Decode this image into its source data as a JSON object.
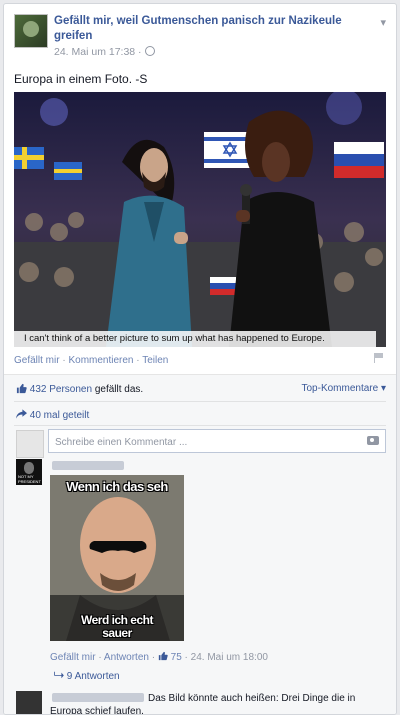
{
  "post": {
    "page_name": "Gefällt mir, weil Gutmenschen panisch zur Nazikeule greifen",
    "timestamp": "24. Mai um 17:38 ·",
    "text": "Europa in einem Foto. -S",
    "photo_caption": "I can't think of a better picture to sum up what has happened to Europe.",
    "actions": {
      "like": "Gefällt mir",
      "comment": "Kommentieren",
      "share": "Teilen",
      "separator": "·"
    }
  },
  "ufi": {
    "likes_count": "432 Personen",
    "likes_suffix": "gefällt das.",
    "top_comments": "Top-Kommentare ▾",
    "shares": "40 mal geteilt",
    "comment_placeholder": "Schreibe einen Kommentar ..."
  },
  "comments": [
    {
      "avatar_text": "NOT MY PRESIDENT",
      "meme_top": "Wenn ich das seh",
      "meme_bottom1": "Werd ich echt",
      "meme_bottom2": "sauer",
      "like": "Gefällt mir",
      "reply": "Antworten",
      "likes": "75",
      "time": "24. Mai um 18:00",
      "replies": "9 Antworten"
    },
    {
      "text": "Das Bild könnte auch heißen: Drei Dinge die in Europa schief laufen."
    }
  ],
  "colors": {
    "link": "#3b5998",
    "muted": "#9197a3",
    "background": "#e9eaed"
  }
}
